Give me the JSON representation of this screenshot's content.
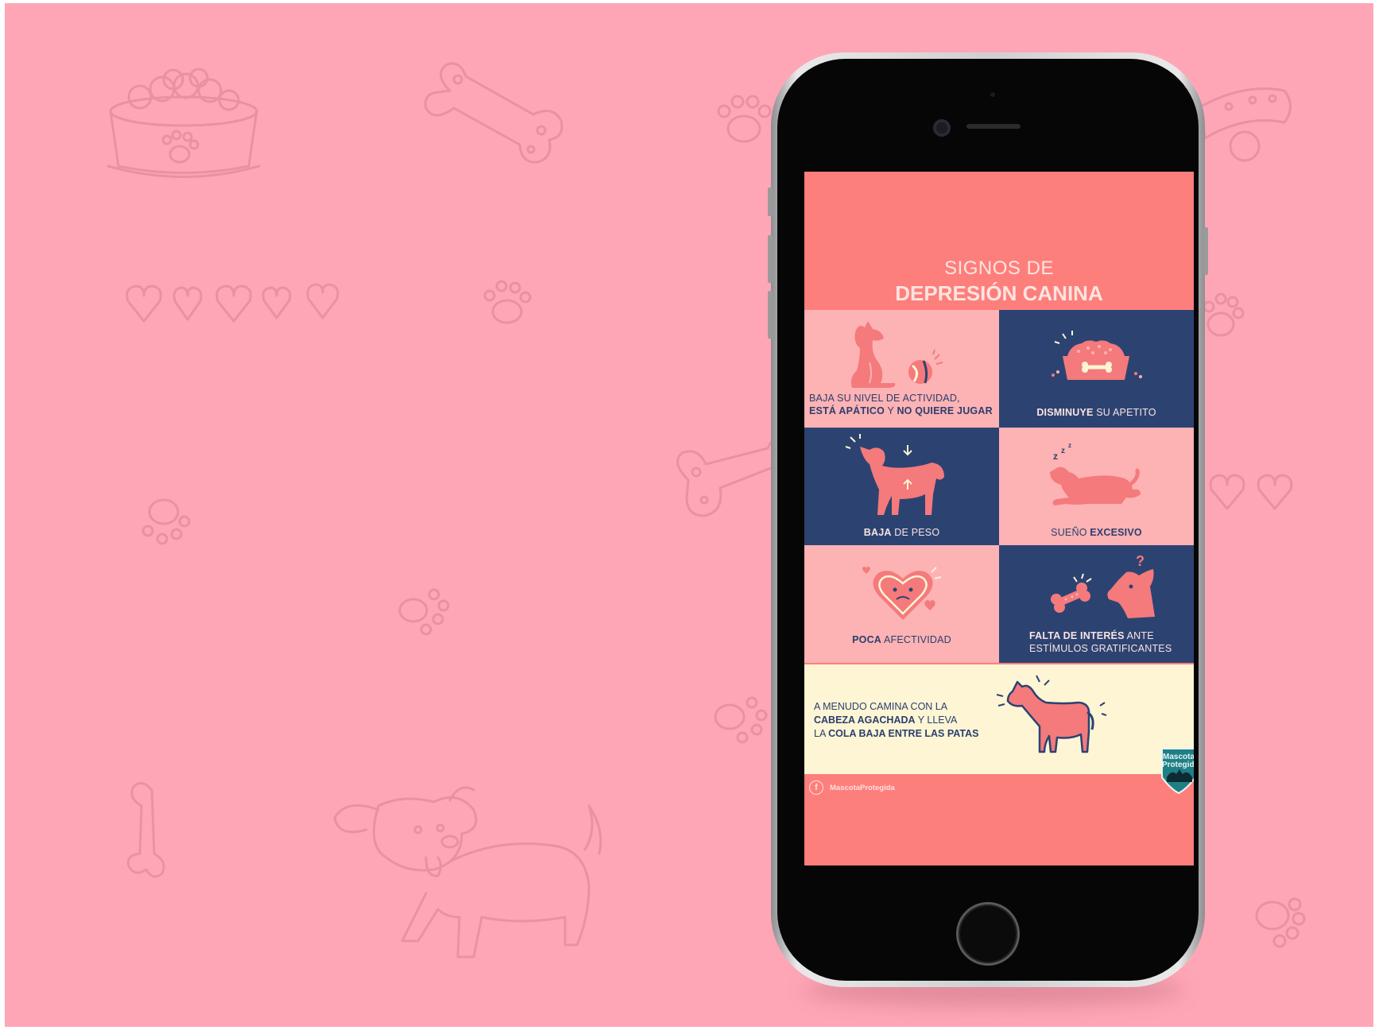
{
  "colors": {
    "background": "#fea6b6",
    "doodle": "#e58e9f",
    "screen_coral": "#fd7f7c",
    "cell_pink": "#fdb2b4",
    "cell_navy": "#2c4372",
    "banner_cream": "#fdf5d4",
    "illustration_coral": "#f47a7c"
  },
  "infographic": {
    "title_line1": "SIGNOS DE",
    "title_line2": "DEPRESIÓN CANINA",
    "cells": [
      {
        "icon": "dog-with-ball-icon",
        "line1": "BAJA SU NIVEL DE ACTIVIDAD,",
        "line2_bold1": "ESTÁ APÁTICO",
        "line2_plain": " Y ",
        "line2_bold2": "NO QUIERE JUGAR"
      },
      {
        "icon": "food-bowl-icon",
        "bold": "DISMINUYE",
        "plain": " SU APETITO"
      },
      {
        "icon": "thin-dog-icon",
        "bold": "BAJA",
        "plain": " DE PESO"
      },
      {
        "icon": "sleeping-dog-icon",
        "plain": "SUEÑO ",
        "bold": "EXCESIVO"
      },
      {
        "icon": "sad-heart-icon",
        "bold": "POCA",
        "plain": " AFECTIVIDAD"
      },
      {
        "icon": "bone-and-dog-icon",
        "line1_bold": "FALTA DE INTERÉS",
        "line1_plain": " ANTE",
        "line2": "ESTÍMULOS GRATIFICANTES"
      }
    ],
    "banner": {
      "icon": "head-down-dog-icon",
      "line1": "A MENUDO CAMINA CON LA",
      "line2_bold": "CABEZA AGACHADA",
      "line2_plain": " Y LLEVA",
      "line3_plain": "LA ",
      "line3_bold": "COLA BAJA ENTRE LAS PATAS"
    },
    "footer_social_icon": "f",
    "footer_handle": "MascotaProtegida",
    "badge_line1": "Mascota",
    "badge_line2": "Protegida"
  }
}
